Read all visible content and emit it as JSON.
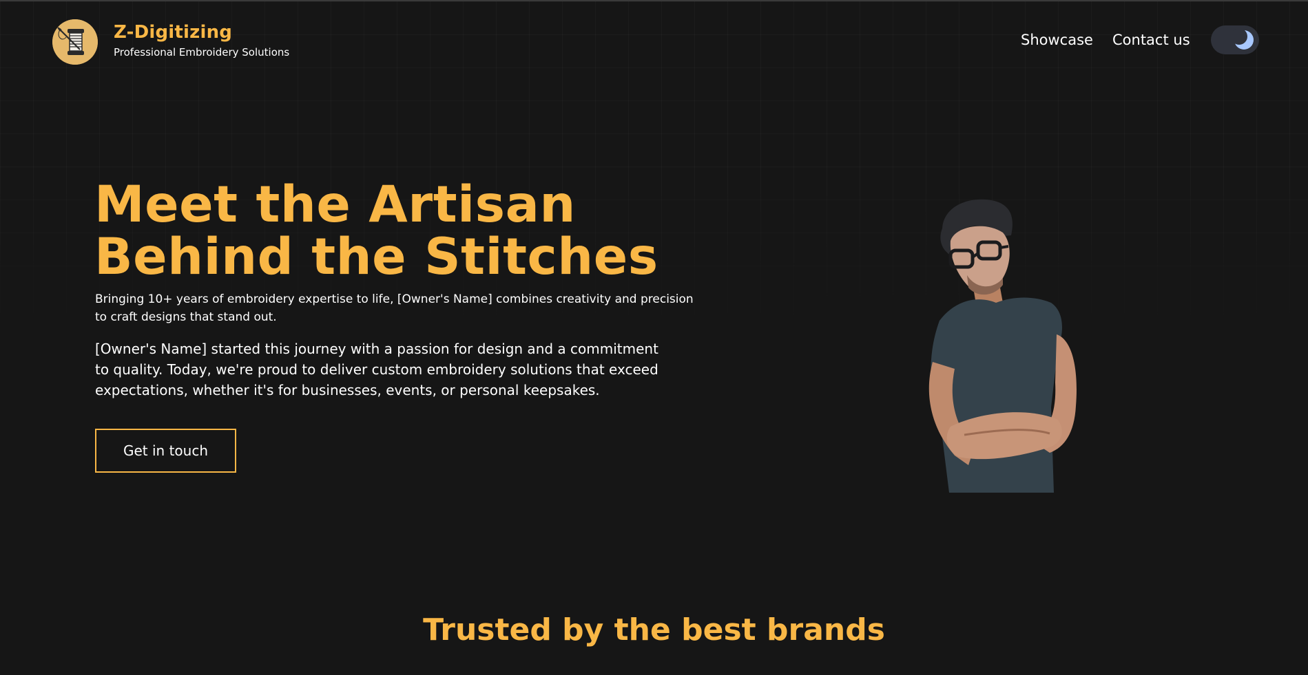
{
  "header": {
    "brand_name": "Z-Digitizing",
    "brand_tagline": "Professional Embroidery Solutions",
    "nav": [
      {
        "label": "Showcase"
      },
      {
        "label": "Contact us"
      }
    ],
    "theme_toggle": {
      "state": "dark",
      "icon": "moon-icon"
    },
    "logo_icon": "spool-needle-icon"
  },
  "hero": {
    "title_line1": "Meet the Artisan",
    "title_line2": "Behind the Stitches",
    "subtitle": "Bringing 10+ years of embroidery expertise to life, [Owner's Name] combines creativity and precision to craft designs that stand out.",
    "body": "[Owner's Name] started this journey with a passion for design and a commitment to quality. Today, we're proud to deliver custom embroidery solutions that exceed expectations, whether it's for businesses, events, or personal keepsakes.",
    "cta_label": "Get in touch"
  },
  "brands_section": {
    "title": "Trusted by the best brands"
  },
  "colors": {
    "accent": "#f9b746",
    "background": "#161616",
    "text": "#ffffff",
    "toggle_bg": "#2f323b",
    "moon": "#a8c8ff"
  }
}
